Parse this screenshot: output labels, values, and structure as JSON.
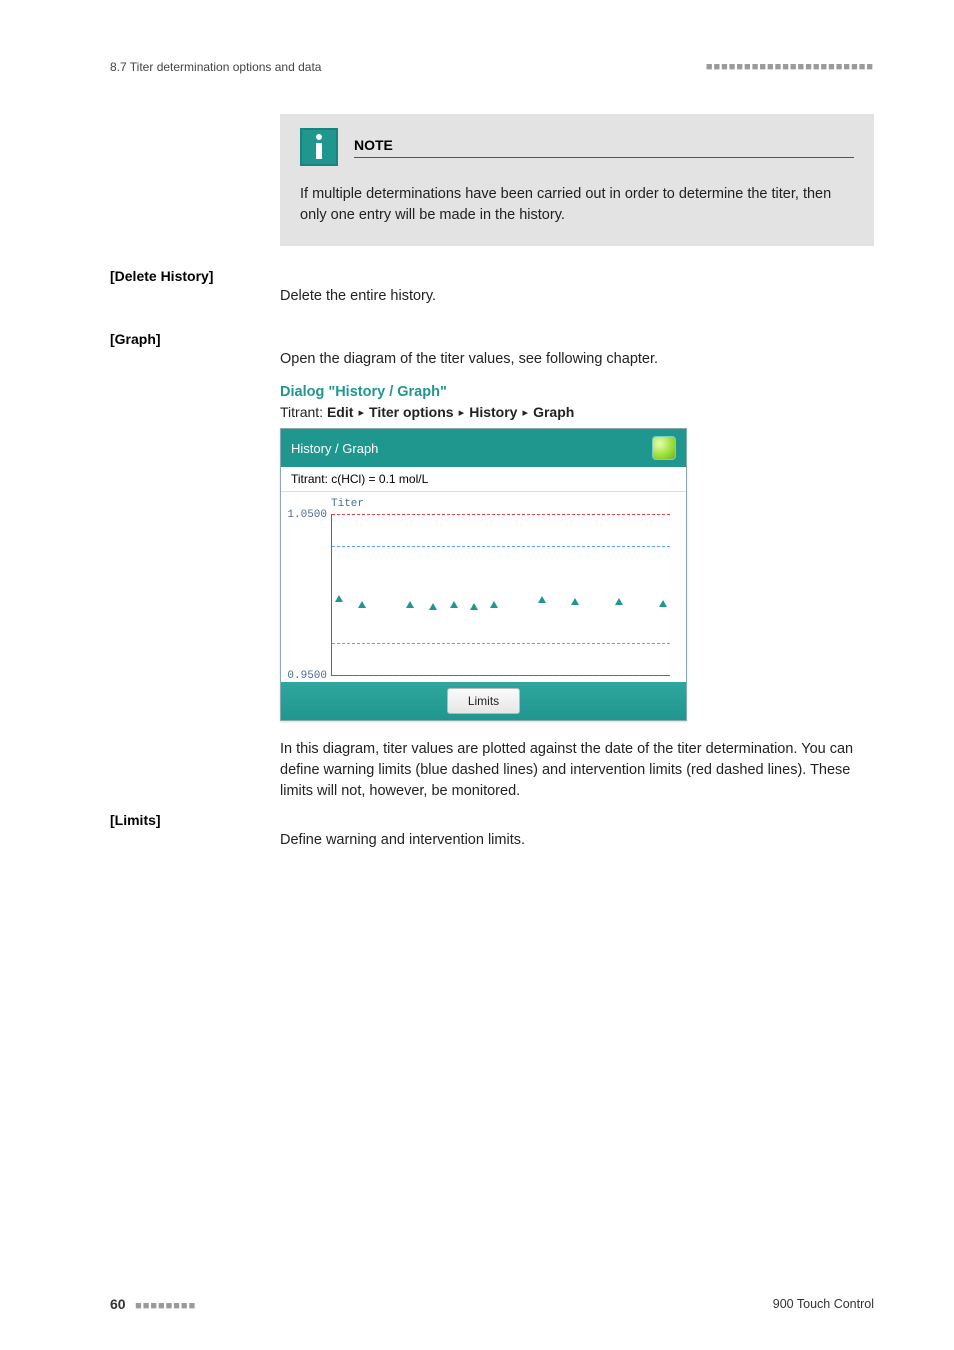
{
  "header": {
    "section": "8.7 Titer determination options and data",
    "squares": "■■■■■■■■■■■■■■■■■■■■■■"
  },
  "note": {
    "label": "NOTE",
    "text": "If multiple determinations have been carried out in order to determine the titer, then only one entry will be made in the history."
  },
  "terms": {
    "delete_history": {
      "label": "[Delete History]",
      "desc": "Delete the entire history."
    },
    "graph": {
      "label": "[Graph]",
      "desc": "Open the diagram of the titer values, see following chapter."
    },
    "limits": {
      "label": "[Limits]",
      "desc": "Define warning and intervention limits."
    }
  },
  "dialog": {
    "title": "Dialog \"History / Graph\"",
    "breadcrumb_prefix": "Titrant: ",
    "breadcrumb": [
      "Edit",
      "Titer options",
      "History",
      "Graph"
    ]
  },
  "screenshot": {
    "header": "History / Graph",
    "subtitle": "Titrant: c(HCl) = 0.1 mol/L",
    "chart_title": "Titer",
    "ytick_top": "1.0500",
    "ytick_bottom": "0.9500",
    "button": "Limits"
  },
  "chart_data": {
    "type": "scatter",
    "title": "Titer",
    "xlabel": "",
    "ylabel": "Titer",
    "ylim": [
      0.95,
      1.05
    ],
    "intervention_limits": [
      0.95,
      1.05
    ],
    "warning_limits": [
      0.97,
      1.03
    ],
    "x": [
      1,
      2,
      3,
      4,
      5,
      6,
      7,
      8,
      9,
      10,
      11
    ],
    "values": [
      0.998,
      0.994,
      0.994,
      0.993,
      0.994,
      0.993,
      0.994,
      0.997,
      0.996,
      0.996,
      0.995
    ]
  },
  "explain": "In this diagram, titer values are plotted against the date of the titer determination. You can define warning limits (blue dashed lines) and intervention limits (red dashed lines). These limits will not, however, be monitored.",
  "footer": {
    "page": "60",
    "squares": "■■■■■■■■",
    "product": "900 Touch Control"
  }
}
